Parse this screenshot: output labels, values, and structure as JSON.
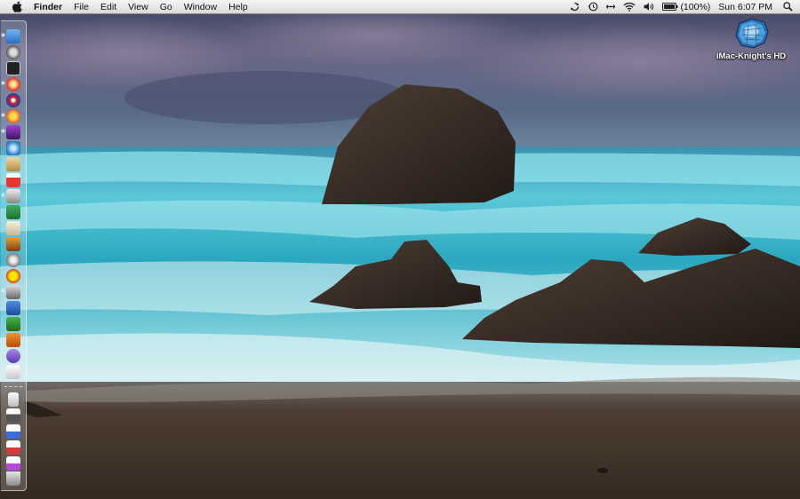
{
  "menubar": {
    "app_name": "Finder",
    "menus": [
      "File",
      "Edit",
      "View",
      "Go",
      "Window",
      "Help"
    ],
    "battery_percent": "(100%)",
    "clock": "Sun 6:07 PM"
  },
  "desktop": {
    "hd_label": "iMac-Knight's HD"
  },
  "dock": {
    "orientation": "left",
    "item_count": 27
  },
  "colors": {
    "menubar_bg": "#e4e4e4",
    "sea": "#39b3c8",
    "sky": "#4a5676",
    "sand": "#3a2e25"
  }
}
